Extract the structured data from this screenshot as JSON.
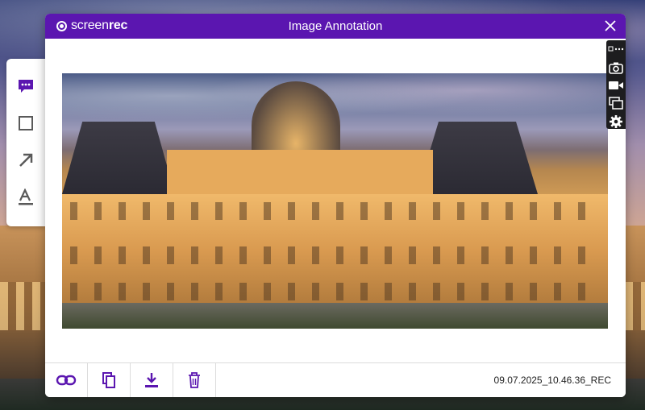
{
  "brand": {
    "name_part1": "screen",
    "name_part2": "rec"
  },
  "window": {
    "title": "Image Annotation"
  },
  "left_tools": [
    "speech-bubble-icon",
    "rectangle-icon",
    "arrow-icon",
    "text-highlight-icon"
  ],
  "right_tools": [
    "more-options-icon",
    "camera-icon",
    "video-camera-icon",
    "windows-icon",
    "gear-icon"
  ],
  "footer": {
    "actions": [
      "link-icon",
      "copy-icon",
      "download-icon",
      "trash-icon"
    ],
    "filename": "09.07.2025_10.46.36_REC"
  },
  "colors": {
    "accent": "#5b16b0",
    "icon_purple": "#5b16b0",
    "icon_gray": "#5a5a5a",
    "dark_toolbar": "#1d1d1f"
  }
}
